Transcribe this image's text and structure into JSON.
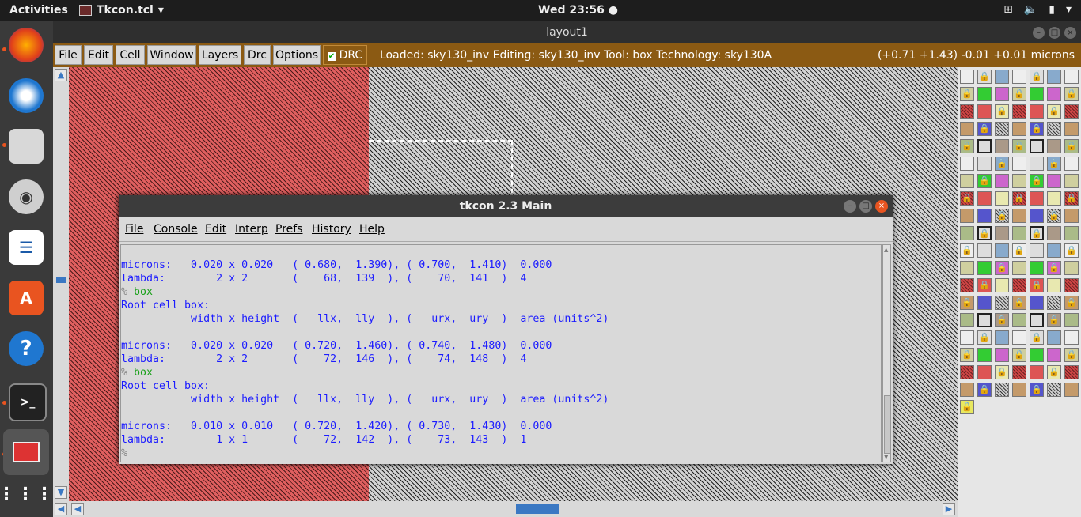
{
  "topbar": {
    "activities": "Activities",
    "app_name": "Tkcon.tcl",
    "clock": "Wed 23:56"
  },
  "magic": {
    "title": "layout1",
    "menus": [
      "File",
      "Edit",
      "Cell",
      "Window",
      "Layers",
      "Drc",
      "Options"
    ],
    "drc_label": "DRC",
    "status": "Loaded: sky130_inv Editing: sky130_inv Tool: box  Technology: sky130A",
    "coords": "(+0.71 +1.43) -0.01 +0.01 microns"
  },
  "tkcon": {
    "title": "tkcon 2.3 Main",
    "menus": [
      "File",
      "Console",
      "Edit",
      "Interp",
      "Prefs",
      "History",
      "Help"
    ],
    "lines": [
      "microns:   0.020 x 0.020   ( 0.680,  1.390), ( 0.700,  1.410)  0.000",
      "lambda:        2 x 2       (    68,  139  ), (    70,  141  )  4",
      "% box",
      "Root cell box:",
      "           width x height  (   llx,  lly  ), (   urx,  ury  )  area (units^2)",
      "",
      "microns:   0.020 x 0.020   ( 0.720,  1.460), ( 0.740,  1.480)  0.000",
      "lambda:        2 x 2       (    72,  146  ), (    74,  148  )  4",
      "% box",
      "Root cell box:",
      "           width x height  (   llx,  lly  ), (   urx,  ury  )  area (units^2)",
      "",
      "microns:   0.010 x 0.010   ( 0.720,  1.420), ( 0.730,  1.430)  0.000",
      "lambda:        1 x 1       (    72,  142  ), (    73,  143  )  1",
      "%"
    ]
  },
  "colors": {
    "menubar_bg": "#8b5a13",
    "console_text": "#1c1cff",
    "command_text": "#18a018",
    "red_layer": "#e05f5f"
  },
  "dock_icons": [
    "firefox-icon",
    "thunderbird-icon",
    "files-icon",
    "rhythmbox-icon",
    "writer-icon",
    "software-icon",
    "help-icon",
    "terminal-icon",
    "magic-icon",
    "apps-grid-icon"
  ]
}
